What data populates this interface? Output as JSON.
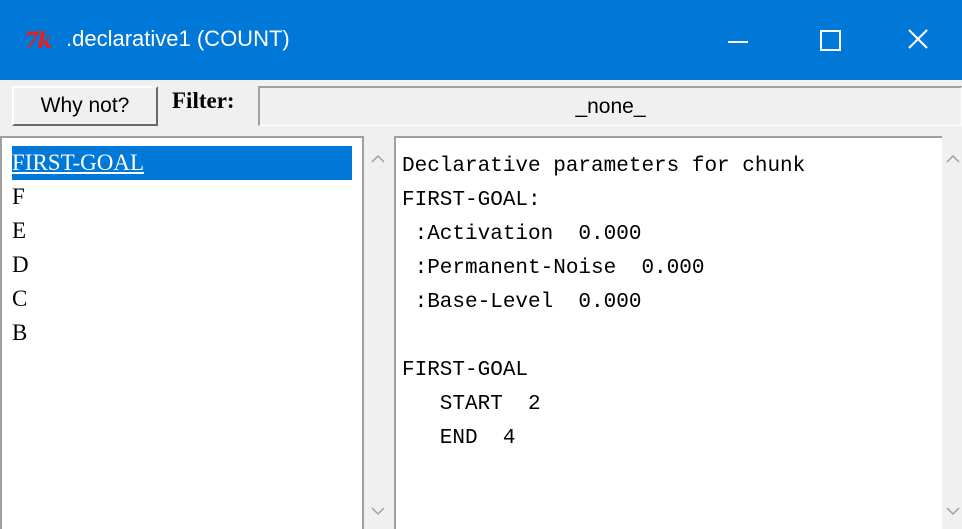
{
  "window": {
    "logo_text": "7k",
    "title": ".declarative1 (COUNT)"
  },
  "toolbar": {
    "why_not_label": "Why not?",
    "filter_label": "Filter:",
    "filter_value": "_none_"
  },
  "chunk_list": {
    "items": [
      "FIRST-GOAL",
      "F",
      "E",
      "D",
      "C",
      "B"
    ],
    "selected": "FIRST-GOAL"
  },
  "details": {
    "lines": [
      "Declarative parameters for chunk",
      "FIRST-GOAL:",
      " :Activation  0.000",
      " :Permanent-Noise  0.000",
      " :Base-Level  0.000",
      "",
      "FIRST-GOAL",
      "   START  2",
      "   END  4"
    ]
  },
  "icons": {
    "minimize": "minimize-icon",
    "maximize": "maximize-icon",
    "close": "close-icon",
    "scroll_up": "chevron-up-icon",
    "scroll_down": "chevron-down-icon"
  },
  "colors": {
    "titlebar": "#0078d7",
    "selection": "#0078d7",
    "logo": "#e81e1e"
  }
}
